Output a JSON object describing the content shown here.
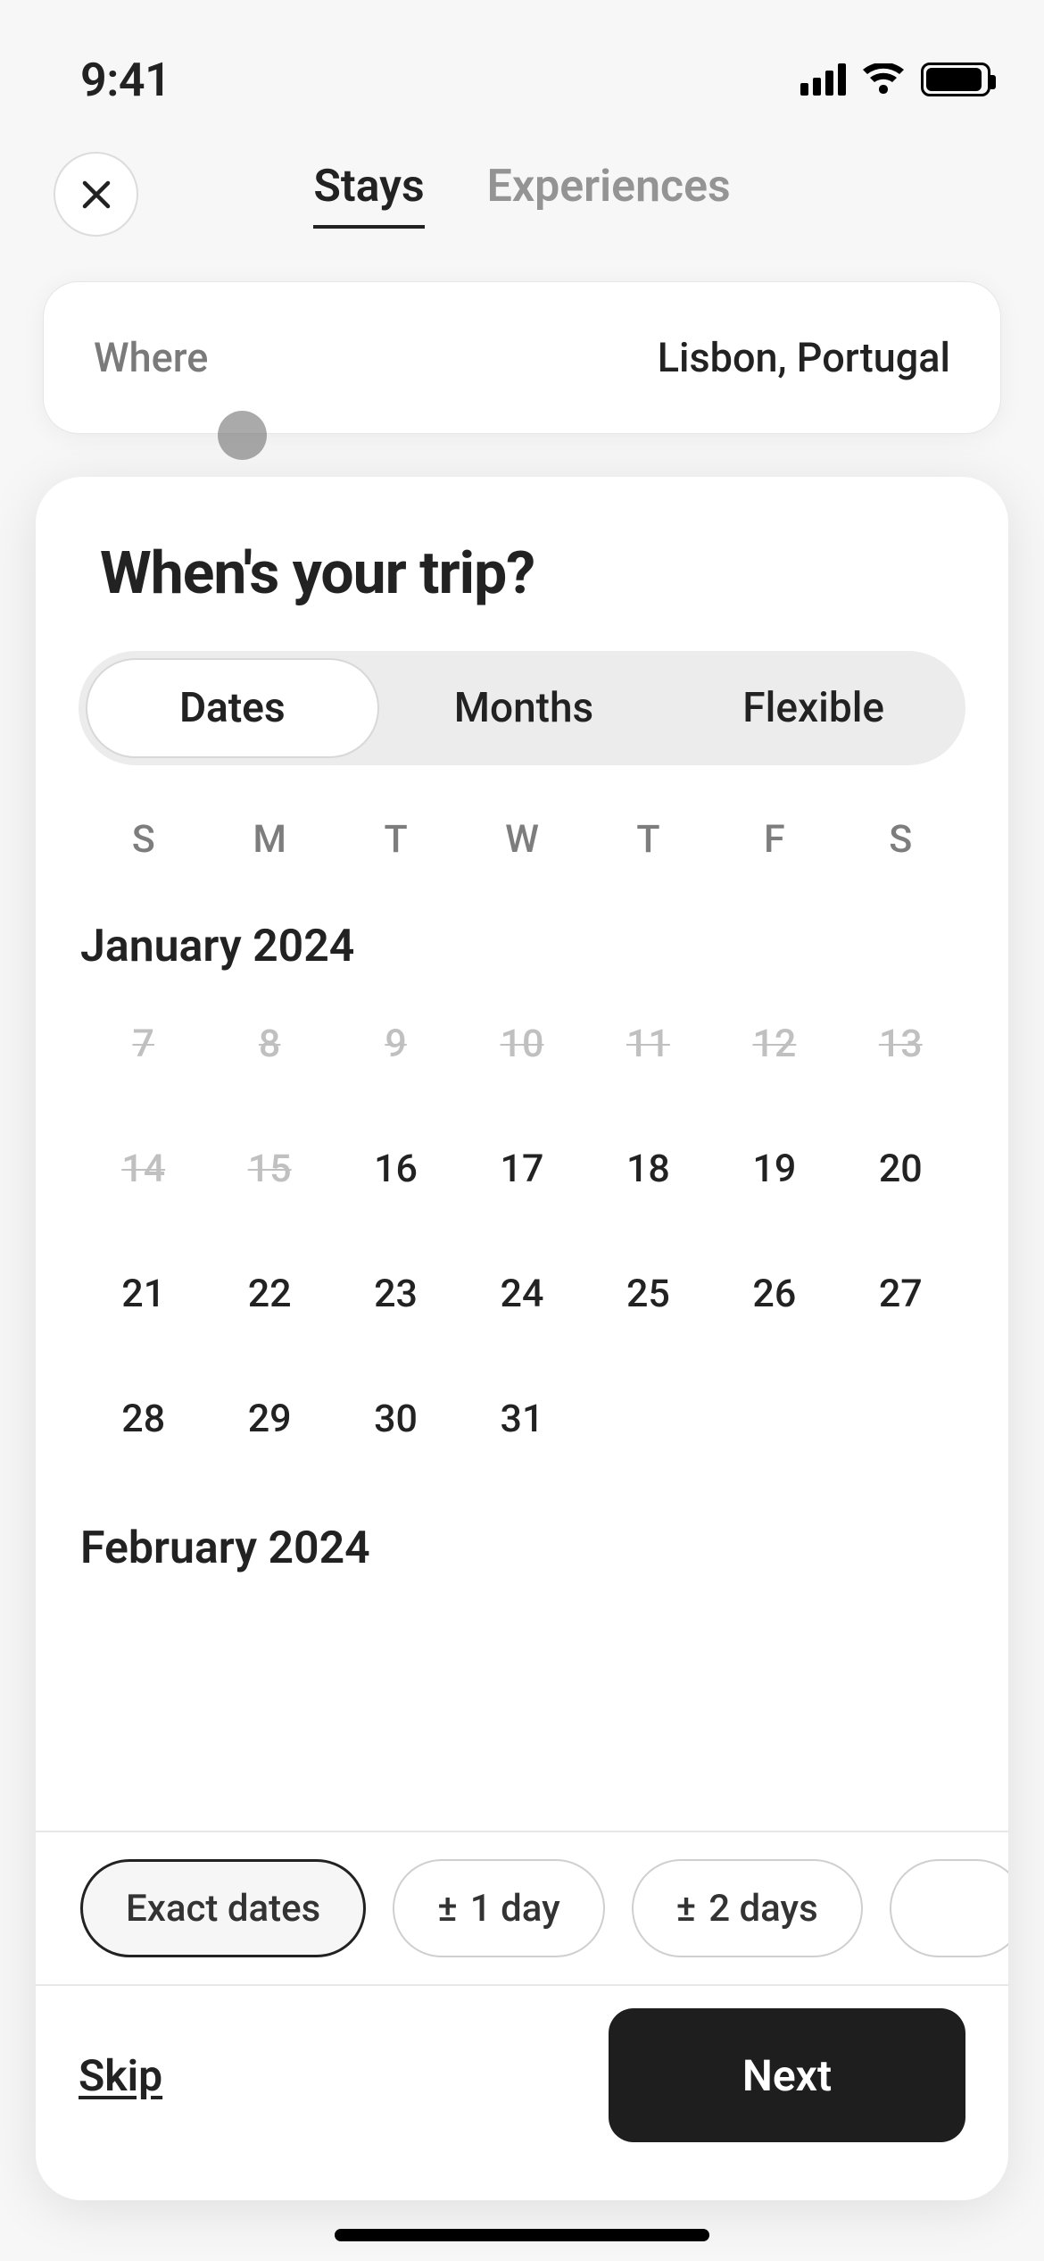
{
  "status": {
    "time": "9:41"
  },
  "header": {
    "tabs": {
      "stays": "Stays",
      "experiences": "Experiences"
    }
  },
  "where": {
    "label": "Where",
    "value": "Lisbon, Portugal"
  },
  "trip": {
    "title": "When's your trip?"
  },
  "segmented": {
    "dates": "Dates",
    "months": "Months",
    "flexible": "Flexible"
  },
  "weekdays": [
    "S",
    "M",
    "T",
    "W",
    "T",
    "F",
    "S"
  ],
  "months_list": [
    {
      "title": "January 2024",
      "rows": [
        [
          {
            "d": "7",
            "dis": true
          },
          {
            "d": "8",
            "dis": true
          },
          {
            "d": "9",
            "dis": true
          },
          {
            "d": "10",
            "dis": true
          },
          {
            "d": "11",
            "dis": true
          },
          {
            "d": "12",
            "dis": true
          },
          {
            "d": "13",
            "dis": true
          }
        ],
        [
          {
            "d": "14",
            "dis": true
          },
          {
            "d": "15",
            "dis": true
          },
          {
            "d": "16"
          },
          {
            "d": "17"
          },
          {
            "d": "18"
          },
          {
            "d": "19"
          },
          {
            "d": "20"
          }
        ],
        [
          {
            "d": "21"
          },
          {
            "d": "22"
          },
          {
            "d": "23"
          },
          {
            "d": "24"
          },
          {
            "d": "25"
          },
          {
            "d": "26"
          },
          {
            "d": "27"
          }
        ],
        [
          {
            "d": "28"
          },
          {
            "d": "29"
          },
          {
            "d": "30"
          },
          {
            "d": "31"
          },
          {
            "empty": true
          },
          {
            "empty": true
          },
          {
            "empty": true
          }
        ]
      ]
    },
    {
      "title": "February 2024",
      "rows": []
    }
  ],
  "flex_pills": {
    "exact": "Exact dates",
    "one_day": "1 day",
    "two_days": "2 days"
  },
  "footer": {
    "skip": "Skip",
    "next": "Next"
  }
}
